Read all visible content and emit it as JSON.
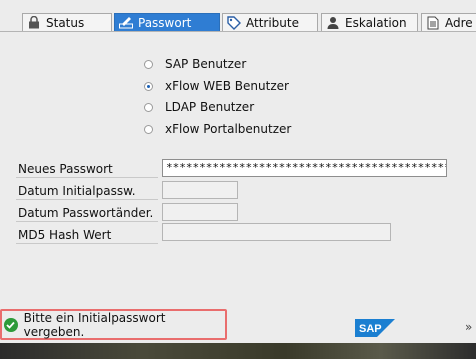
{
  "tabs": [
    {
      "label": "Status",
      "icon": "lock-icon",
      "active": false
    },
    {
      "label": "Passwort",
      "icon": "password-edit-icon",
      "active": true
    },
    {
      "label": "Attribute",
      "icon": "tag-icon",
      "active": false
    },
    {
      "label": "Eskalation",
      "icon": "user-icon",
      "active": false
    },
    {
      "label": "Adre",
      "icon": "document-icon",
      "active": false
    }
  ],
  "user_types": {
    "options": [
      {
        "label": "SAP Benutzer",
        "selected": false
      },
      {
        "label": "xFlow WEB Benutzer",
        "selected": true
      },
      {
        "label": "LDAP Benutzer",
        "selected": false
      },
      {
        "label": "xFlow Portalbenutzer",
        "selected": false
      }
    ]
  },
  "fields": {
    "new_password": {
      "label": "Neues Passwort",
      "value": "********************************************"
    },
    "initial_pw_date": {
      "label": "Datum Initialpassw.",
      "value": ""
    },
    "pw_change_date": {
      "label": "Datum Passwortänder.",
      "value": ""
    },
    "md5_hash": {
      "label": "MD5 Hash Wert",
      "value": ""
    }
  },
  "status": {
    "message": "Bitte ein Initialpasswort vergeben.",
    "type": "success",
    "icon": "success-check-icon",
    "logo": "SAP",
    "overflow": "»"
  },
  "colors": {
    "active_tab": "#2f7dd3",
    "status_highlight": "#e96d6d",
    "success": "#2e9a3a",
    "sap_blue": "#1b7fd1"
  }
}
